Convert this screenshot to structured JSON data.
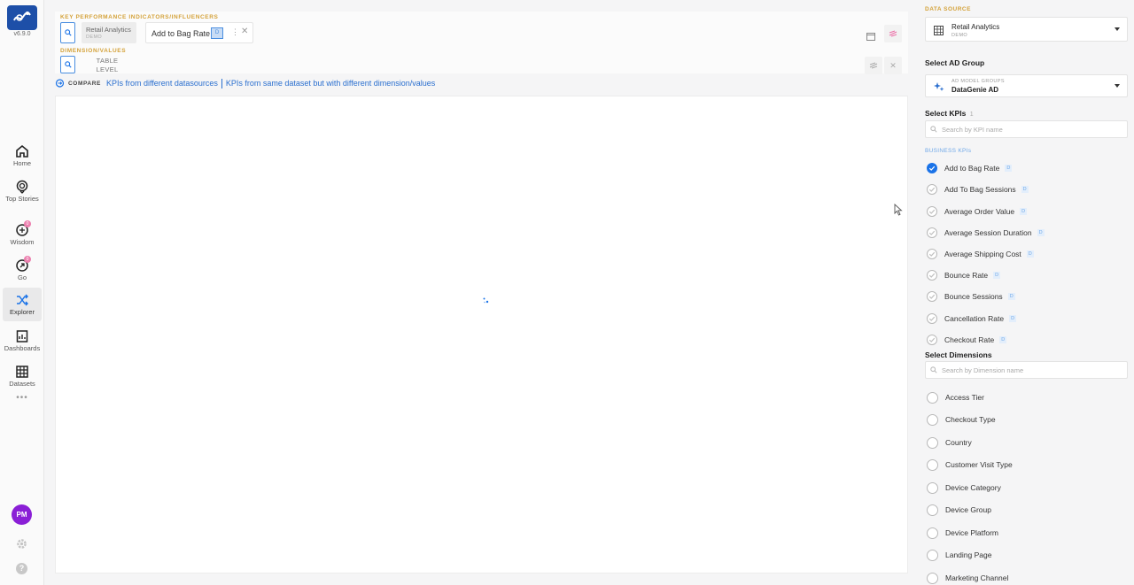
{
  "app": {
    "version": "v6.9.0",
    "brand_color": "#1d4fa8",
    "accent": "#1a73e8",
    "highlight": "#d4a23a"
  },
  "nav": {
    "items": [
      {
        "label": "Home",
        "icon": "home-icon"
      },
      {
        "label": "Top Stories",
        "icon": "stories-icon"
      },
      {
        "label": "Wisdom",
        "icon": "wisdom-icon",
        "badge": "0"
      },
      {
        "label": "Go",
        "icon": "go-icon",
        "badge": "0"
      },
      {
        "label": "Explorer",
        "icon": "shuffle-icon",
        "active": true
      },
      {
        "label": "Dashboards",
        "icon": "dashboards-icon"
      },
      {
        "label": "Datasets",
        "icon": "datasets-icon"
      }
    ],
    "more": "•••",
    "avatar": "PM"
  },
  "kpi_section": {
    "title": "KEY PERFORMANCE INDICATORS/INFLUENCERS",
    "datasource_chip": {
      "name": "Retail Analytics",
      "sub": "DEMO"
    },
    "kpi_chip": {
      "name": "Add to Bag Rate",
      "tag": "D"
    }
  },
  "dimension_section": {
    "title": "DIMENSION/VALUES",
    "table_level": "TABLE LEVEL"
  },
  "compare": {
    "label": "COMPARE",
    "link1": "KPIs from different datasources",
    "link2": "KPIs from same dataset but with different dimension/values"
  },
  "right": {
    "data_source_title": "DATA SOURCE",
    "data_source": {
      "name": "Retail Analytics",
      "sub": "DEMO"
    },
    "ad_group_title": "Select AD Group",
    "ad_group": {
      "sub": "AD MODEL GROUPS",
      "name": "DataGenie AD"
    },
    "kpis_title": "Select KPIs",
    "kpis_count": "1",
    "kpi_search_placeholder": "Search by KPI name",
    "business_kpis_label": "BUSINESS KPIs",
    "kpis": [
      {
        "name": "Add to Bag Rate",
        "tag": "D",
        "checked": true
      },
      {
        "name": "Add To Bag Sessions",
        "tag": "D"
      },
      {
        "name": "Average Order Value",
        "tag": "D"
      },
      {
        "name": "Average Session Duration",
        "tag": "D"
      },
      {
        "name": "Average Shipping Cost",
        "tag": "D"
      },
      {
        "name": "Bounce Rate",
        "tag": "D"
      },
      {
        "name": "Bounce Sessions",
        "tag": "D"
      },
      {
        "name": "Cancellation Rate",
        "tag": "D"
      },
      {
        "name": "Checkout Rate",
        "tag": "D"
      }
    ],
    "dims_title": "Select Dimensions",
    "dim_search_placeholder": "Search by Dimension name",
    "dimensions": [
      "Access Tier",
      "Checkout Type",
      "Country",
      "Customer Visit Type",
      "Device Category",
      "Device Group",
      "Device Platform",
      "Landing Page",
      "Marketing Channel"
    ]
  }
}
